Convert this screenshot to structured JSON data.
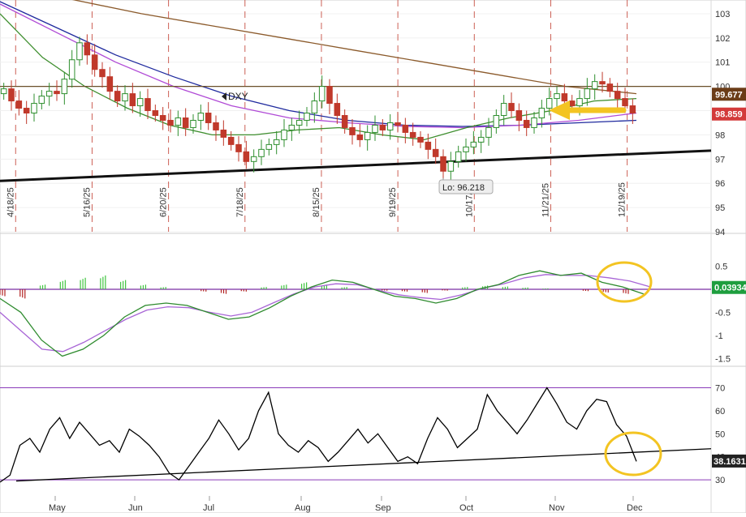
{
  "chart_data": [
    {
      "type": "candlestick",
      "symbol": "DXY",
      "ylim": [
        94,
        103.5
      ],
      "y_ticks": [
        94,
        95,
        96,
        97,
        98,
        99,
        100,
        101,
        102,
        103
      ],
      "date_markers": [
        "4/18/25",
        "5/16/25",
        "6/20/25",
        "7/18/25",
        "8/15/25",
        "9/19/25",
        "10/17/25",
        "11/21/25",
        "12/19/25"
      ],
      "x_months": [
        "May",
        "Jun",
        "Jul",
        "Aug",
        "Sep",
        "Oct",
        "Nov",
        "Dec"
      ],
      "low_label": "Lo: 96.218",
      "low_value": 96.218,
      "price_tags": [
        {
          "text": "99.677",
          "value": 99.677,
          "color": "#6b3c17"
        },
        {
          "text": "98.859",
          "value": 98.859,
          "color": "#d33a3a"
        }
      ],
      "resistance_level": 100,
      "support_trendline": [
        [
          0,
          96.1
        ],
        [
          1,
          97.35
        ]
      ],
      "moving_averages": [
        {
          "color": "#8b5a2b",
          "values": [
            103.9,
            103.6,
            103.0,
            102.5,
            102.0,
            101.5,
            101.0,
            100.5,
            100.0,
            99.7
          ]
        },
        {
          "color": "#1f2a9e",
          "values": [
            103.5,
            102.4,
            101.3,
            100.4,
            99.6,
            99.0,
            98.6,
            98.4,
            98.35,
            98.4,
            98.5,
            98.6
          ]
        },
        {
          "color": "#b04ad6",
          "values": [
            103.4,
            102.2,
            101.0,
            100.0,
            99.2,
            98.7,
            98.5,
            98.35,
            98.3,
            98.4,
            98.6,
            98.9
          ]
        },
        {
          "color": "#3e8e2e",
          "values": [
            103.0,
            101.2,
            100.0,
            99.1,
            98.4,
            98.0,
            98.0,
            98.2,
            98.3,
            98.0,
            97.8,
            98.3,
            98.7,
            99.0,
            99.4,
            99.5
          ]
        }
      ],
      "closes": [
        99.9,
        99.4,
        99.1,
        98.9,
        99.3,
        99.6,
        99.8,
        99.7,
        100.3,
        101.1,
        101.8,
        101.3,
        100.7,
        100.4,
        99.8,
        99.4,
        99.7,
        99.2,
        99.5,
        99.0,
        98.8,
        98.6,
        98.4,
        98.7,
        98.3,
        98.6,
        98.9,
        98.5,
        98.2,
        97.9,
        97.6,
        97.3,
        96.9,
        97.1,
        97.4,
        97.6,
        97.8,
        98.2,
        98.4,
        98.6,
        98.9,
        99.4,
        100.0,
        99.3,
        98.8,
        98.3,
        98.0,
        97.8,
        98.1,
        98.4,
        98.2,
        98.5,
        98.4,
        98.1,
        97.9,
        97.7,
        97.4,
        97.1,
        96.5,
        96.9,
        97.3,
        97.5,
        97.7,
        97.9,
        98.3,
        98.8,
        99.3,
        99.0,
        98.6,
        98.3,
        98.7,
        99.1,
        99.5,
        99.7,
        99.4,
        99.2,
        99.5,
        99.9,
        100.2,
        100.1,
        99.8,
        99.5,
        99.2,
        98.9
      ]
    },
    {
      "type": "macd",
      "ylim": [
        -1.6,
        0.65
      ],
      "y_ticks": [
        0.5,
        -0.5,
        -1,
        -1.5
      ],
      "value_tag": {
        "text": "0.03934",
        "value": 0.03934,
        "color": "#1e9e3e"
      },
      "macd": [
        -0.2,
        -0.5,
        -1.1,
        -1.45,
        -1.3,
        -1.0,
        -0.6,
        -0.35,
        -0.3,
        -0.35,
        -0.5,
        -0.65,
        -0.6,
        -0.4,
        -0.15,
        0.05,
        0.2,
        0.15,
        0.0,
        -0.15,
        -0.2,
        -0.3,
        -0.2,
        0.0,
        0.1,
        0.3,
        0.4,
        0.3,
        0.35,
        0.15,
        0.05,
        -0.1
      ],
      "signal": [
        -0.5,
        -0.9,
        -1.3,
        -1.35,
        -1.15,
        -0.9,
        -0.65,
        -0.45,
        -0.38,
        -0.4,
        -0.5,
        -0.58,
        -0.5,
        -0.3,
        -0.1,
        0.05,
        0.12,
        0.1,
        -0.02,
        -0.12,
        -0.18,
        -0.22,
        -0.12,
        0.02,
        0.12,
        0.25,
        0.32,
        0.3,
        0.3,
        0.25,
        0.18,
        0.05
      ],
      "histogram": [
        -0.15,
        -0.2,
        0.1,
        0.2,
        0.25,
        0.3,
        0.2,
        0.1,
        0.05,
        0.0,
        -0.05,
        -0.1,
        -0.05,
        0.05,
        0.1,
        0.15,
        0.1,
        0.05,
        0.0,
        -0.03,
        -0.05,
        -0.08,
        -0.03,
        0.05,
        0.08,
        0.06,
        0.04,
        0.02,
        0.0,
        -0.04,
        -0.07,
        -0.1
      ],
      "colors": {
        "macd": "#2e8b2e",
        "signal": "#a865d6",
        "hist_up": "#3ec43e",
        "hist_down": "#b22222"
      }
    },
    {
      "type": "rsi",
      "ylim": [
        23,
        73
      ],
      "y_ticks": [
        30,
        40,
        50,
        60,
        70
      ],
      "bands": [
        30,
        70
      ],
      "value_tag": {
        "text": "38.1631",
        "value": 38.1631,
        "color": "#222222"
      },
      "values": [
        29,
        32,
        45,
        48,
        42,
        52,
        57,
        48,
        55,
        50,
        45,
        47,
        42,
        52,
        49,
        45,
        40,
        33,
        30,
        36,
        42,
        48,
        56,
        50,
        43,
        48,
        60,
        68,
        50,
        45,
        42,
        47,
        44,
        38,
        42,
        47,
        52,
        46,
        50,
        44,
        38,
        40,
        37,
        48,
        57,
        52,
        44,
        48,
        52,
        67,
        60,
        55,
        50,
        56,
        63,
        70,
        63,
        55,
        52,
        60,
        65,
        64,
        54,
        49,
        38
      ],
      "trendline": [
        [
          0,
          29.5
        ],
        [
          1,
          43.5
        ]
      ],
      "colors": {
        "line": "#000000",
        "band": "#8a3ab9",
        "trend": "#000000"
      }
    }
  ],
  "annotations": {
    "arrow_color": "#f3c422",
    "circle_color": "#f3c422"
  }
}
